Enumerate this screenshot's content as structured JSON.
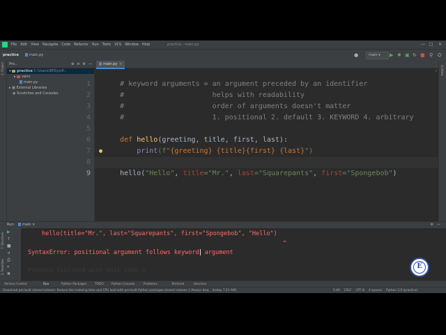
{
  "menubar": {
    "items": [
      "File",
      "Edit",
      "View",
      "Navigate",
      "Code",
      "Refactor",
      "Run",
      "Tools",
      "VCS",
      "Window",
      "Help"
    ],
    "title": "practice - main.py"
  },
  "navbar": {
    "project": "practice",
    "file": "main.py",
    "run_config": "main"
  },
  "left_strip": {
    "project_label": "1: Project",
    "structure_label": "7: Structure",
    "favorites_label": "2: Favorites"
  },
  "right_strip": {
    "label": "SciView"
  },
  "project_panel": {
    "header": "Pro...",
    "tree": [
      {
        "label": "practice",
        "meta": "C:\\Users\\BPDys\\P..."
      },
      {
        "label": "venv",
        "meta": ""
      },
      {
        "label": "main.py",
        "meta": ""
      },
      {
        "label": "External Libraries",
        "meta": ""
      },
      {
        "label": "Scratches and Consoles",
        "meta": ""
      }
    ]
  },
  "editor": {
    "tab": "main.py",
    "line_numbers": [
      "1",
      "2",
      "3",
      "4",
      "5",
      "6",
      "7",
      "8",
      "9"
    ],
    "code": {
      "l1": "# keyword arguments = an argument preceded by an identifier",
      "l2": "#                     helps with readability",
      "l3": "#                     order of arguments doesn't matter",
      "l4": "#                     1. positional 2. default 3. KEYWORD 4. arbitrary",
      "l6_def": "def",
      "l6_name": "hello",
      "l6_rest_a": "(greeting, title, first, last):",
      "l7_indent": "    ",
      "l7_print": "print",
      "l7_f": "(f\"",
      "l7_b1": "{greeting}",
      "l7_s1": " ",
      "l7_b2": "{title}",
      "l7_b3": "{first}",
      "l7_s2": " ",
      "l7_b4": "{last}",
      "l7_end": "\")",
      "l9_call": "hello(",
      "l9_a1": "\"Hello\"",
      "l9_c1": ", ",
      "l9_k1": "title",
      "l9_v1": "=\"Mr.\"",
      "l9_c2": ", ",
      "l9_k2": "last",
      "l9_v2": "=\"Squarepants\"",
      "l9_c3": ", ",
      "l9_k3": "first",
      "l9_v3": "=\"Spongebob\"",
      "l9_end": ")"
    }
  },
  "run_panel": {
    "label": "Run:",
    "file": "main",
    "console": {
      "line1": "hello(title=\"Mr.\", last=\"Squarepants\", first=\"Spongebob\", \"Hello\")",
      "caret": "^",
      "line2_a": "SyntaxError: positional argument follows keyword",
      "line2_b": " argument",
      "line3": "Process finished with exit code 1"
    }
  },
  "bottom_tabs": [
    "Version Control",
    "Run",
    "Python Packages",
    "TODO",
    "Python Console",
    "Problems",
    "Terminal",
    "Services"
  ],
  "statusbar": {
    "message": "Download pre-built shared indexes: Reduce the indexing time and CPU load with pre-built Python packages shared indexes // Always dow... (today 7:21 AM)",
    "position": "5:49",
    "line_sep": "CRLF",
    "encoding": "UTF-8",
    "indent": "4 spaces",
    "interpreter": "Python 3.9 (practice)"
  },
  "colors": {
    "background": "#2b2b2b",
    "comment": "#808080",
    "keyword": "#cc7832",
    "function": "#ffc66d",
    "string": "#6a8759",
    "param": "#aa4926",
    "error": "#ff6b68"
  }
}
